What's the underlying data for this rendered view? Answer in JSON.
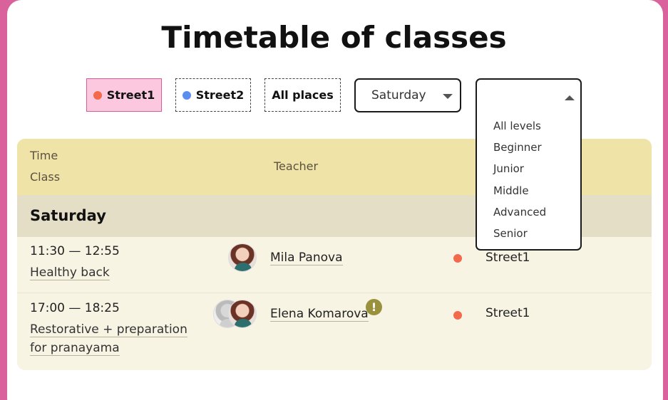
{
  "title": "Timetable of classes",
  "filters": {
    "places": [
      {
        "label": "Street1",
        "color": "#f26a4b",
        "active": true
      },
      {
        "label": "Street2",
        "color": "#5c8ef0",
        "active": false
      },
      {
        "label": "All places",
        "active": false
      }
    ],
    "day_select": {
      "selected": "Saturday"
    },
    "level_select": {
      "selected": "",
      "options": [
        "All levels",
        "Beginner",
        "Junior",
        "Middle",
        "Advanced",
        "Senior"
      ]
    }
  },
  "table": {
    "headers": {
      "time": "Time",
      "class": "Class",
      "teacher": "Teacher"
    },
    "day": "Saturday",
    "rows": [
      {
        "time": "11:30 — 12:55",
        "class": "Healthy back",
        "teacher": "Mila Panova",
        "place": "Street1",
        "place_color": "#f26a4b",
        "warning": false
      },
      {
        "time": "17:00 — 18:25",
        "class": "Restorative + preparation for pranayama",
        "teacher": "Elena Komarova",
        "place": "Street1",
        "place_color": "#f26a4b",
        "warning": true,
        "warning_symbol": "!"
      }
    ]
  }
}
